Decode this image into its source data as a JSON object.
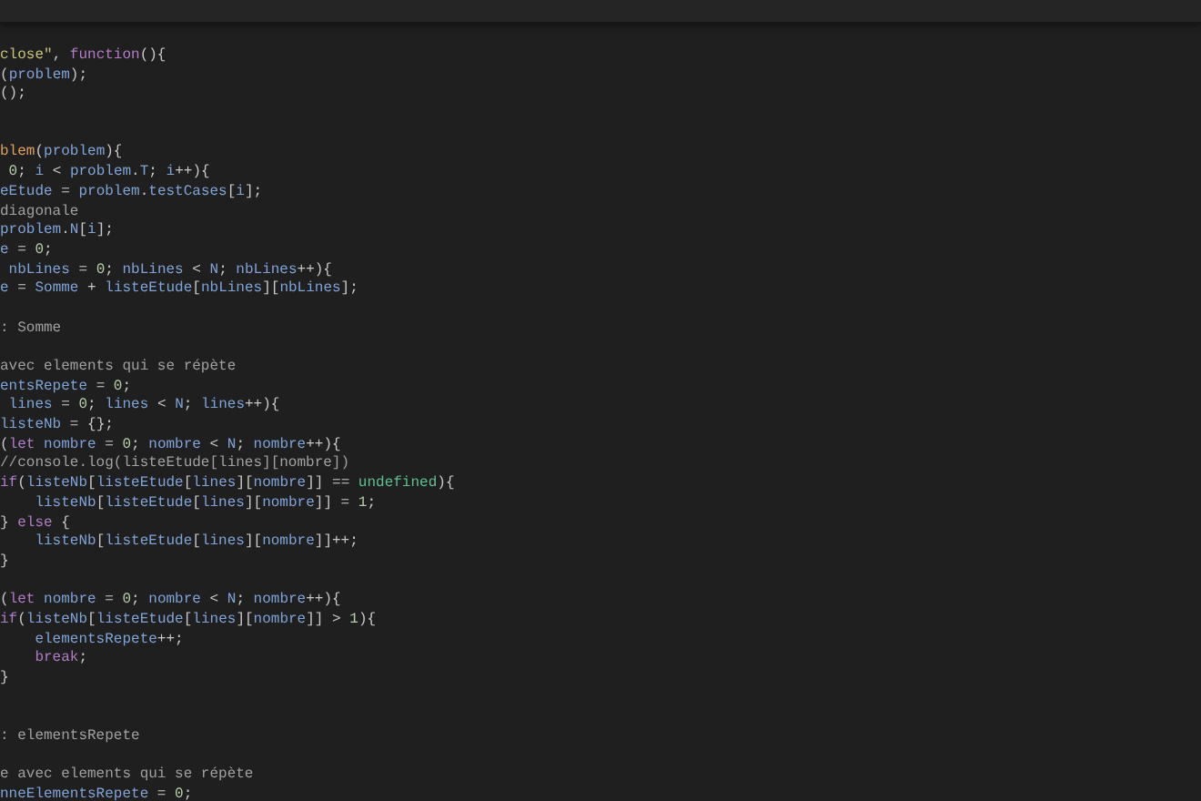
{
  "editor": {
    "lines": [
      {
        "kind": "code",
        "tokens": [
          {
            "text": "close\"",
            "kind": "string"
          },
          {
            "text": ", ",
            "kind": "plain"
          },
          {
            "text": "function",
            "kind": "keyword"
          },
          {
            "text": "(){",
            "kind": "plain"
          }
        ]
      },
      {
        "kind": "code",
        "tokens": [
          {
            "text": "(",
            "kind": "plain"
          },
          {
            "text": "problem",
            "kind": "variable"
          },
          {
            "text": ");",
            "kind": "plain"
          }
        ]
      },
      {
        "kind": "code",
        "tokens": [
          {
            "text": "();",
            "kind": "plain"
          }
        ]
      },
      {
        "kind": "blank"
      },
      {
        "kind": "blank"
      },
      {
        "kind": "code",
        "tokens": [
          {
            "text": "blem",
            "kind": "function"
          },
          {
            "text": "(",
            "kind": "plain"
          },
          {
            "text": "problem",
            "kind": "variable"
          },
          {
            "text": "){",
            "kind": "plain"
          }
        ]
      },
      {
        "kind": "code",
        "tokens": [
          {
            "text": " 0",
            "kind": "number"
          },
          {
            "text": "; ",
            "kind": "plain"
          },
          {
            "text": "i",
            "kind": "variable"
          },
          {
            "text": " < ",
            "kind": "plain"
          },
          {
            "text": "problem",
            "kind": "variable"
          },
          {
            "text": ".",
            "kind": "plain"
          },
          {
            "text": "T",
            "kind": "variable"
          },
          {
            "text": "; ",
            "kind": "plain"
          },
          {
            "text": "i",
            "kind": "variable"
          },
          {
            "text": "++){",
            "kind": "plain"
          }
        ]
      },
      {
        "kind": "code",
        "tokens": [
          {
            "text": "eEtude",
            "kind": "variable"
          },
          {
            "text": " = ",
            "kind": "plain"
          },
          {
            "text": "problem",
            "kind": "variable"
          },
          {
            "text": ".",
            "kind": "plain"
          },
          {
            "text": "testCases",
            "kind": "variable"
          },
          {
            "text": "[",
            "kind": "plain"
          },
          {
            "text": "i",
            "kind": "variable"
          },
          {
            "text": "];",
            "kind": "plain"
          }
        ]
      },
      {
        "kind": "code",
        "tokens": [
          {
            "text": "diagonale",
            "kind": "comment"
          }
        ]
      },
      {
        "kind": "code",
        "tokens": [
          {
            "text": "problem",
            "kind": "variable"
          },
          {
            "text": ".",
            "kind": "plain"
          },
          {
            "text": "N",
            "kind": "variable"
          },
          {
            "text": "[",
            "kind": "plain"
          },
          {
            "text": "i",
            "kind": "variable"
          },
          {
            "text": "];",
            "kind": "plain"
          }
        ]
      },
      {
        "kind": "code",
        "tokens": [
          {
            "text": "e",
            "kind": "variable"
          },
          {
            "text": " = ",
            "kind": "plain"
          },
          {
            "text": "0",
            "kind": "number"
          },
          {
            "text": ";",
            "kind": "plain"
          }
        ]
      },
      {
        "kind": "code",
        "tokens": [
          {
            "text": " nbLines",
            "kind": "variable"
          },
          {
            "text": " = ",
            "kind": "plain"
          },
          {
            "text": "0",
            "kind": "number"
          },
          {
            "text": "; ",
            "kind": "plain"
          },
          {
            "text": "nbLines",
            "kind": "variable"
          },
          {
            "text": " < ",
            "kind": "plain"
          },
          {
            "text": "N",
            "kind": "variable"
          },
          {
            "text": "; ",
            "kind": "plain"
          },
          {
            "text": "nbLines",
            "kind": "variable"
          },
          {
            "text": "++){",
            "kind": "plain"
          }
        ]
      },
      {
        "kind": "code",
        "tokens": [
          {
            "text": "e",
            "kind": "variable"
          },
          {
            "text": " = ",
            "kind": "plain"
          },
          {
            "text": "Somme",
            "kind": "variable"
          },
          {
            "text": " + ",
            "kind": "plain"
          },
          {
            "text": "listeEtude",
            "kind": "variable"
          },
          {
            "text": "[",
            "kind": "plain"
          },
          {
            "text": "nbLines",
            "kind": "variable"
          },
          {
            "text": "][",
            "kind": "plain"
          },
          {
            "text": "nbLines",
            "kind": "variable"
          },
          {
            "text": "];",
            "kind": "plain"
          }
        ]
      },
      {
        "kind": "blank"
      },
      {
        "kind": "code",
        "tokens": [
          {
            "text": ": Somme",
            "kind": "comment"
          }
        ]
      },
      {
        "kind": "blank"
      },
      {
        "kind": "code",
        "tokens": [
          {
            "text": "avec elements qui se répète",
            "kind": "comment"
          }
        ]
      },
      {
        "kind": "code",
        "tokens": [
          {
            "text": "entsRepete",
            "kind": "variable"
          },
          {
            "text": " = ",
            "kind": "plain"
          },
          {
            "text": "0",
            "kind": "number"
          },
          {
            "text": ";",
            "kind": "plain"
          }
        ]
      },
      {
        "kind": "code",
        "tokens": [
          {
            "text": " lines",
            "kind": "variable"
          },
          {
            "text": " = ",
            "kind": "plain"
          },
          {
            "text": "0",
            "kind": "number"
          },
          {
            "text": "; ",
            "kind": "plain"
          },
          {
            "text": "lines",
            "kind": "variable"
          },
          {
            "text": " < ",
            "kind": "plain"
          },
          {
            "text": "N",
            "kind": "variable"
          },
          {
            "text": "; ",
            "kind": "plain"
          },
          {
            "text": "lines",
            "kind": "variable"
          },
          {
            "text": "++){",
            "kind": "plain"
          }
        ]
      },
      {
        "kind": "code",
        "tokens": [
          {
            "text": "listeNb",
            "kind": "variable"
          },
          {
            "text": " = {};",
            "kind": "plain"
          }
        ]
      },
      {
        "kind": "code",
        "tokens": [
          {
            "text": "(",
            "kind": "plain"
          },
          {
            "text": "let",
            "kind": "keyword"
          },
          {
            "text": " nombre",
            "kind": "variable"
          },
          {
            "text": " = ",
            "kind": "plain"
          },
          {
            "text": "0",
            "kind": "number"
          },
          {
            "text": "; ",
            "kind": "plain"
          },
          {
            "text": "nombre",
            "kind": "variable"
          },
          {
            "text": " < ",
            "kind": "plain"
          },
          {
            "text": "N",
            "kind": "variable"
          },
          {
            "text": "; ",
            "kind": "plain"
          },
          {
            "text": "nombre",
            "kind": "variable"
          },
          {
            "text": "++){",
            "kind": "plain"
          }
        ]
      },
      {
        "kind": "code",
        "tokens": [
          {
            "text": "//console.log(listeEtude[lines][nombre])",
            "kind": "comment"
          }
        ]
      },
      {
        "kind": "code",
        "tokens": [
          {
            "text": "if",
            "kind": "keyword"
          },
          {
            "text": "(",
            "kind": "plain"
          },
          {
            "text": "listeNb",
            "kind": "variable"
          },
          {
            "text": "[",
            "kind": "plain"
          },
          {
            "text": "listeEtude",
            "kind": "variable"
          },
          {
            "text": "[",
            "kind": "plain"
          },
          {
            "text": "lines",
            "kind": "variable"
          },
          {
            "text": "][",
            "kind": "plain"
          },
          {
            "text": "nombre",
            "kind": "variable"
          },
          {
            "text": "]] == ",
            "kind": "plain"
          },
          {
            "text": "undefined",
            "kind": "constant"
          },
          {
            "text": "){",
            "kind": "plain"
          }
        ]
      },
      {
        "kind": "code",
        "tokens": [
          {
            "text": "    listeNb",
            "kind": "variable"
          },
          {
            "text": "[",
            "kind": "plain"
          },
          {
            "text": "listeEtude",
            "kind": "variable"
          },
          {
            "text": "[",
            "kind": "plain"
          },
          {
            "text": "lines",
            "kind": "variable"
          },
          {
            "text": "][",
            "kind": "plain"
          },
          {
            "text": "nombre",
            "kind": "variable"
          },
          {
            "text": "]] = ",
            "kind": "plain"
          },
          {
            "text": "1",
            "kind": "number"
          },
          {
            "text": ";",
            "kind": "plain"
          }
        ]
      },
      {
        "kind": "code",
        "tokens": [
          {
            "text": "} ",
            "kind": "plain"
          },
          {
            "text": "else",
            "kind": "keyword"
          },
          {
            "text": " {",
            "kind": "plain"
          }
        ]
      },
      {
        "kind": "code",
        "tokens": [
          {
            "text": "    listeNb",
            "kind": "variable"
          },
          {
            "text": "[",
            "kind": "plain"
          },
          {
            "text": "listeEtude",
            "kind": "variable"
          },
          {
            "text": "[",
            "kind": "plain"
          },
          {
            "text": "lines",
            "kind": "variable"
          },
          {
            "text": "][",
            "kind": "plain"
          },
          {
            "text": "nombre",
            "kind": "variable"
          },
          {
            "text": "]]++;",
            "kind": "plain"
          }
        ]
      },
      {
        "kind": "code",
        "tokens": [
          {
            "text": "}",
            "kind": "plain"
          }
        ]
      },
      {
        "kind": "blank"
      },
      {
        "kind": "code",
        "tokens": [
          {
            "text": "(",
            "kind": "plain"
          },
          {
            "text": "let",
            "kind": "keyword"
          },
          {
            "text": " nombre",
            "kind": "variable"
          },
          {
            "text": " = ",
            "kind": "plain"
          },
          {
            "text": "0",
            "kind": "number"
          },
          {
            "text": "; ",
            "kind": "plain"
          },
          {
            "text": "nombre",
            "kind": "variable"
          },
          {
            "text": " < ",
            "kind": "plain"
          },
          {
            "text": "N",
            "kind": "variable"
          },
          {
            "text": "; ",
            "kind": "plain"
          },
          {
            "text": "nombre",
            "kind": "variable"
          },
          {
            "text": "++){",
            "kind": "plain"
          }
        ]
      },
      {
        "kind": "code",
        "tokens": [
          {
            "text": "if",
            "kind": "keyword"
          },
          {
            "text": "(",
            "kind": "plain"
          },
          {
            "text": "listeNb",
            "kind": "variable"
          },
          {
            "text": "[",
            "kind": "plain"
          },
          {
            "text": "listeEtude",
            "kind": "variable"
          },
          {
            "text": "[",
            "kind": "plain"
          },
          {
            "text": "lines",
            "kind": "variable"
          },
          {
            "text": "][",
            "kind": "plain"
          },
          {
            "text": "nombre",
            "kind": "variable"
          },
          {
            "text": "]] > ",
            "kind": "plain"
          },
          {
            "text": "1",
            "kind": "number"
          },
          {
            "text": "){",
            "kind": "plain"
          }
        ]
      },
      {
        "kind": "code",
        "tokens": [
          {
            "text": "    elementsRepete",
            "kind": "variable"
          },
          {
            "text": "++;",
            "kind": "plain"
          }
        ]
      },
      {
        "kind": "code",
        "tokens": [
          {
            "text": "    break",
            "kind": "keyword"
          },
          {
            "text": ";",
            "kind": "plain"
          }
        ]
      },
      {
        "kind": "code",
        "tokens": [
          {
            "text": "}",
            "kind": "plain"
          }
        ]
      },
      {
        "kind": "blank"
      },
      {
        "kind": "blank"
      },
      {
        "kind": "code",
        "tokens": [
          {
            "text": ": elementsRepete",
            "kind": "comment"
          }
        ]
      },
      {
        "kind": "blank"
      },
      {
        "kind": "code",
        "tokens": [
          {
            "text": "e avec elements qui se répète",
            "kind": "comment"
          }
        ]
      },
      {
        "kind": "code",
        "tokens": [
          {
            "text": "nneElementsRepete",
            "kind": "variable"
          },
          {
            "text": " = ",
            "kind": "plain"
          },
          {
            "text": "0",
            "kind": "number"
          },
          {
            "text": ";",
            "kind": "plain"
          }
        ]
      }
    ]
  }
}
